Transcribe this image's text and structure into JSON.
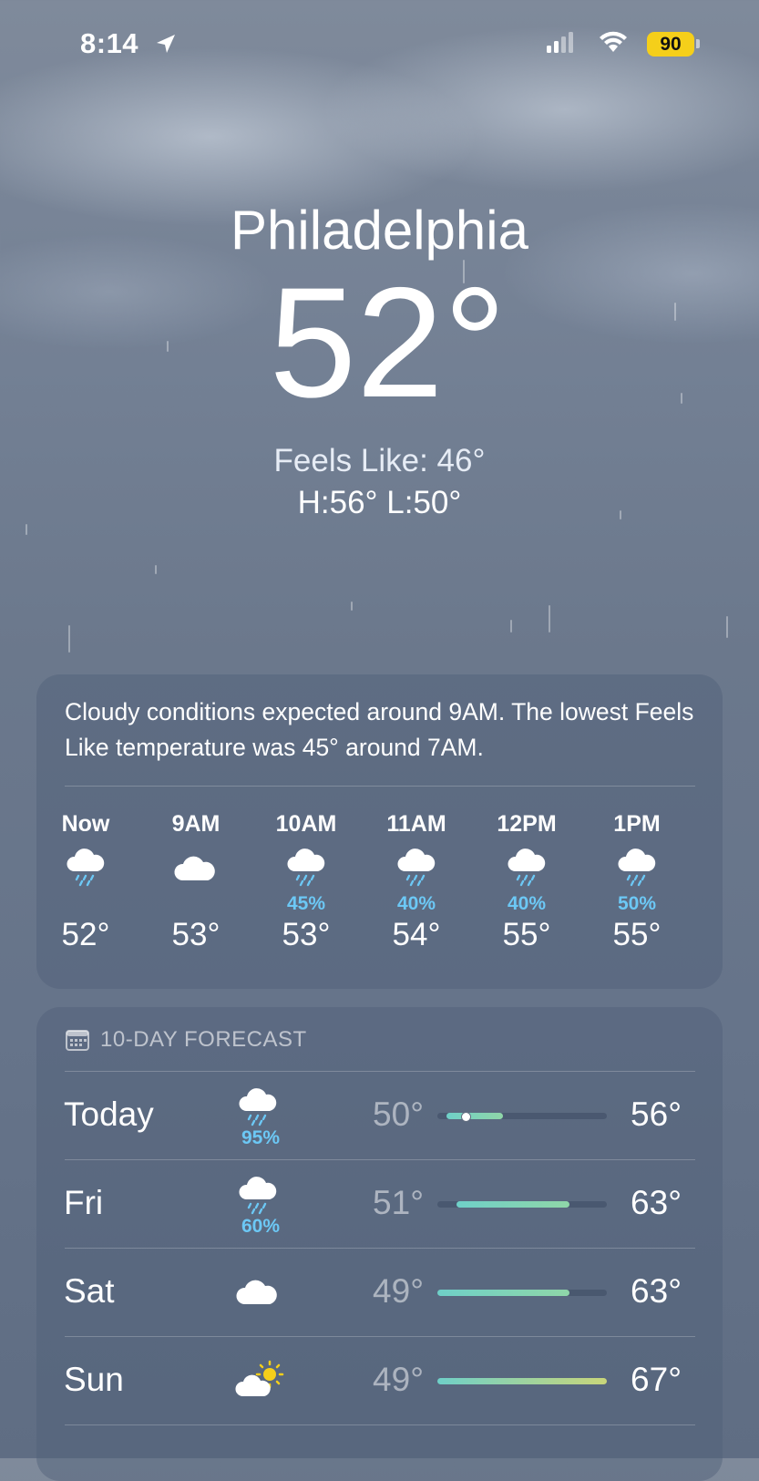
{
  "status_bar": {
    "time": "8:14",
    "battery": "90"
  },
  "current": {
    "city": "Philadelphia",
    "temperature": "52°",
    "feels_like": "Feels Like: 46°",
    "high_low": "H:56°  L:50°"
  },
  "hourly": {
    "summary": "Cloudy conditions expected around 9AM. The lowest Feels Like temperature was 45° around 7AM.",
    "hours": [
      {
        "label": "Now",
        "icon": "rain-cloud-icon",
        "precip": "",
        "temp": "52°"
      },
      {
        "label": "9AM",
        "icon": "cloud-icon",
        "precip": "",
        "temp": "53°"
      },
      {
        "label": "10AM",
        "icon": "rain-cloud-icon",
        "precip": "45%",
        "temp": "53°"
      },
      {
        "label": "11AM",
        "icon": "rain-cloud-icon",
        "precip": "40%",
        "temp": "54°"
      },
      {
        "label": "12PM",
        "icon": "rain-cloud-icon",
        "precip": "40%",
        "temp": "55°"
      },
      {
        "label": "1PM",
        "icon": "rain-cloud-icon",
        "precip": "50%",
        "temp": "55°"
      }
    ]
  },
  "forecast": {
    "title": "10-DAY FORECAST",
    "range_low": 49,
    "range_high": 67,
    "days": [
      {
        "day": "Today",
        "icon": "rain-cloud-icon",
        "precip": "95%",
        "low": "50°",
        "high": "56°",
        "low_val": 50,
        "high_val": 56,
        "current_val": 52
      },
      {
        "day": "Fri",
        "icon": "rain-cloud-icon",
        "precip": "60%",
        "low": "51°",
        "high": "63°",
        "low_val": 51,
        "high_val": 63
      },
      {
        "day": "Sat",
        "icon": "cloud-icon",
        "precip": "",
        "low": "49°",
        "high": "63°",
        "low_val": 49,
        "high_val": 63
      },
      {
        "day": "Sun",
        "icon": "partly-sunny-icon",
        "precip": "",
        "low": "49°",
        "high": "67°",
        "low_val": 49,
        "high_val": 67
      }
    ]
  },
  "colors": {
    "precip": "#6cc8f5",
    "battery": "#f5cf1a",
    "bar_cool": "#6fd0c8",
    "bar_warm": "#c9d67a"
  }
}
